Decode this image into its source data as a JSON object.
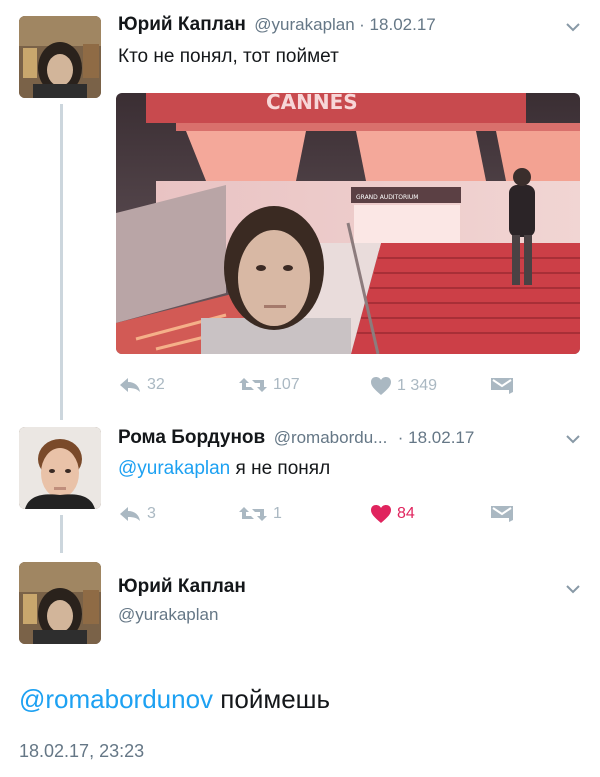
{
  "tweet1": {
    "name": "Юрий Каплан",
    "handle": "@yurakaplan",
    "date": "· 18.02.17",
    "text": "Кто не понял, тот поймет",
    "photo_sign": "CANNES",
    "photo_sign_small": "GRAND AUDITORIUM",
    "replies": "32",
    "retweets": "107",
    "likes": "1 349"
  },
  "tweet2": {
    "name": "Рома Бордунов",
    "handle": "@romabordu...",
    "date": "· 18.02.17",
    "mention": "@yurakaplan",
    "text": " я не понял",
    "replies": "3",
    "retweets": "1",
    "likes": "84"
  },
  "tweet3": {
    "name": "Юрий Каплан",
    "handle": "@yurakaplan",
    "mention": "@romabordunov",
    "text": " поймешь",
    "timestamp": "18.02.17, 23:23"
  },
  "colors": {
    "link": "#1da1f2",
    "muted": "#657786",
    "icon": "#aab8c2",
    "like": "#e0245e",
    "thread_line": "#ccd6dd"
  }
}
